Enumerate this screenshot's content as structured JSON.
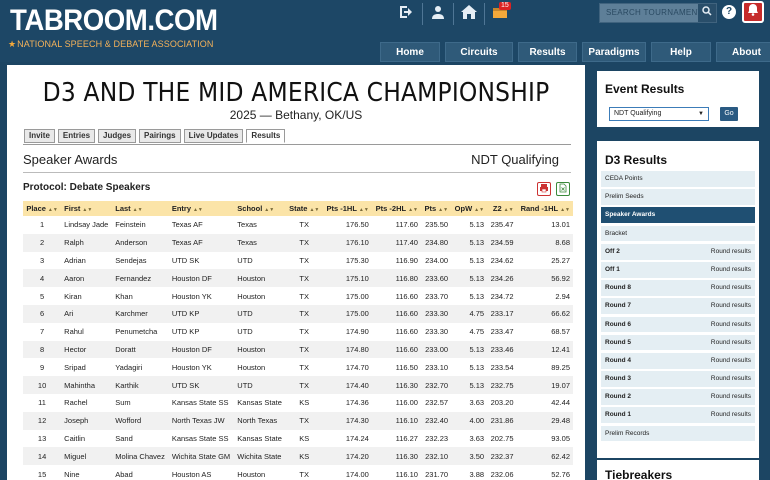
{
  "header": {
    "logo": "TABROOM.COM",
    "tagline": "NATIONAL SPEECH & DEBATE ASSOCIATION",
    "badge_count": "15",
    "search_placeholder": "SEARCH TOURNAMENTS",
    "help": "?",
    "nav": [
      "Home",
      "Circuits",
      "Results",
      "Paradigms",
      "Help",
      "About"
    ]
  },
  "tournament": {
    "title": "D3 AND THE MID AMERICA CHAMPIONSHIP",
    "subtitle": "2025 — Bethany, OK/US"
  },
  "tabs": [
    "Invite",
    "Entries",
    "Judges",
    "Pairings",
    "Live Updates",
    "Results"
  ],
  "section": {
    "title": "Speaker Awards",
    "right": "NDT Qualifying",
    "protocol": "Protocol: Debate Speakers"
  },
  "table": {
    "headers": [
      "Place",
      "First",
      "Last",
      "Entry",
      "School",
      "State",
      "Pts -1HL",
      "Pts -2HL",
      "Pts",
      "OpW",
      "Z2",
      "Rand -1HL"
    ],
    "rows": [
      [
        "1",
        "Lindsay Jade",
        "Feinstein",
        "Texas AF",
        "Texas",
        "TX",
        "176.50",
        "117.60",
        "235.50",
        "5.13",
        "235.47",
        "13.01"
      ],
      [
        "2",
        "Ralph",
        "Anderson",
        "Texas AF",
        "Texas",
        "TX",
        "176.10",
        "117.40",
        "234.80",
        "5.13",
        "234.59",
        "8.68"
      ],
      [
        "3",
        "Adrian",
        "Sendejas",
        "UTD SK",
        "UTD",
        "TX",
        "175.30",
        "116.90",
        "234.00",
        "5.13",
        "234.62",
        "25.27"
      ],
      [
        "4",
        "Aaron",
        "Fernandez",
        "Houston DF",
        "Houston",
        "TX",
        "175.10",
        "116.80",
        "233.60",
        "5.13",
        "234.26",
        "56.92"
      ],
      [
        "5",
        "Kiran",
        "Khan",
        "Houston YK",
        "Houston",
        "TX",
        "175.00",
        "116.60",
        "233.70",
        "5.13",
        "234.72",
        "2.94"
      ],
      [
        "6",
        "Ari",
        "Karchmer",
        "UTD KP",
        "UTD",
        "TX",
        "175.00",
        "116.60",
        "233.30",
        "4.75",
        "233.17",
        "66.62"
      ],
      [
        "7",
        "Rahul",
        "Penumetcha",
        "UTD KP",
        "UTD",
        "TX",
        "174.90",
        "116.60",
        "233.30",
        "4.75",
        "233.47",
        "68.57"
      ],
      [
        "8",
        "Hector",
        "Doratt",
        "Houston DF",
        "Houston",
        "TX",
        "174.80",
        "116.60",
        "233.00",
        "5.13",
        "233.46",
        "12.41"
      ],
      [
        "9",
        "Sripad",
        "Yadagiri",
        "Houston YK",
        "Houston",
        "TX",
        "174.70",
        "116.50",
        "233.10",
        "5.13",
        "233.54",
        "89.25"
      ],
      [
        "10",
        "Mahintha",
        "Karthik",
        "UTD SK",
        "UTD",
        "TX",
        "174.40",
        "116.30",
        "232.70",
        "5.13",
        "232.75",
        "19.07"
      ],
      [
        "11",
        "Rachel",
        "Sum",
        "Kansas State SS",
        "Kansas State",
        "KS",
        "174.36",
        "116.00",
        "232.57",
        "3.63",
        "203.20",
        "42.44"
      ],
      [
        "12",
        "Joseph",
        "Wofford",
        "North Texas JW",
        "North Texas",
        "TX",
        "174.30",
        "116.10",
        "232.40",
        "4.00",
        "231.86",
        "29.48"
      ],
      [
        "13",
        "Caitlin",
        "Sand",
        "Kansas State SS",
        "Kansas State",
        "KS",
        "174.24",
        "116.27",
        "232.23",
        "3.63",
        "202.75",
        "93.05"
      ],
      [
        "14",
        "Miguel",
        "Molina Chavez",
        "Wichita State GM",
        "Wichita State",
        "KS",
        "174.20",
        "116.30",
        "232.10",
        "3.50",
        "232.37",
        "62.42"
      ],
      [
        "15",
        "Nine",
        "Abad",
        "Houston AS",
        "Houston",
        "TX",
        "174.00",
        "116.10",
        "231.70",
        "3.88",
        "232.06",
        "52.76"
      ]
    ]
  },
  "event_results": {
    "title": "Event Results",
    "selected": "NDT Qualifying",
    "go": "Go"
  },
  "d3_results": {
    "title": "D3 Results",
    "items": [
      {
        "label": "CEDA Points",
        "right": ""
      },
      {
        "label": "Prelim Seeds",
        "right": ""
      },
      {
        "label": "Speaker Awards",
        "right": ""
      },
      {
        "label": "Bracket",
        "right": ""
      },
      {
        "label": "Off 2",
        "right": "Round results"
      },
      {
        "label": "Off 1",
        "right": "Round results"
      },
      {
        "label": "Round 8",
        "right": "Round results"
      },
      {
        "label": "Round 7",
        "right": "Round results"
      },
      {
        "label": "Round 6",
        "right": "Round results"
      },
      {
        "label": "Round 5",
        "right": "Round results"
      },
      {
        "label": "Round 4",
        "right": "Round results"
      },
      {
        "label": "Round 3",
        "right": "Round results"
      },
      {
        "label": "Round 2",
        "right": "Round results"
      },
      {
        "label": "Round 1",
        "right": "Round results"
      },
      {
        "label": "Prelim Records",
        "right": ""
      }
    ]
  },
  "tiebreakers": {
    "title": "Tiebreakers"
  }
}
